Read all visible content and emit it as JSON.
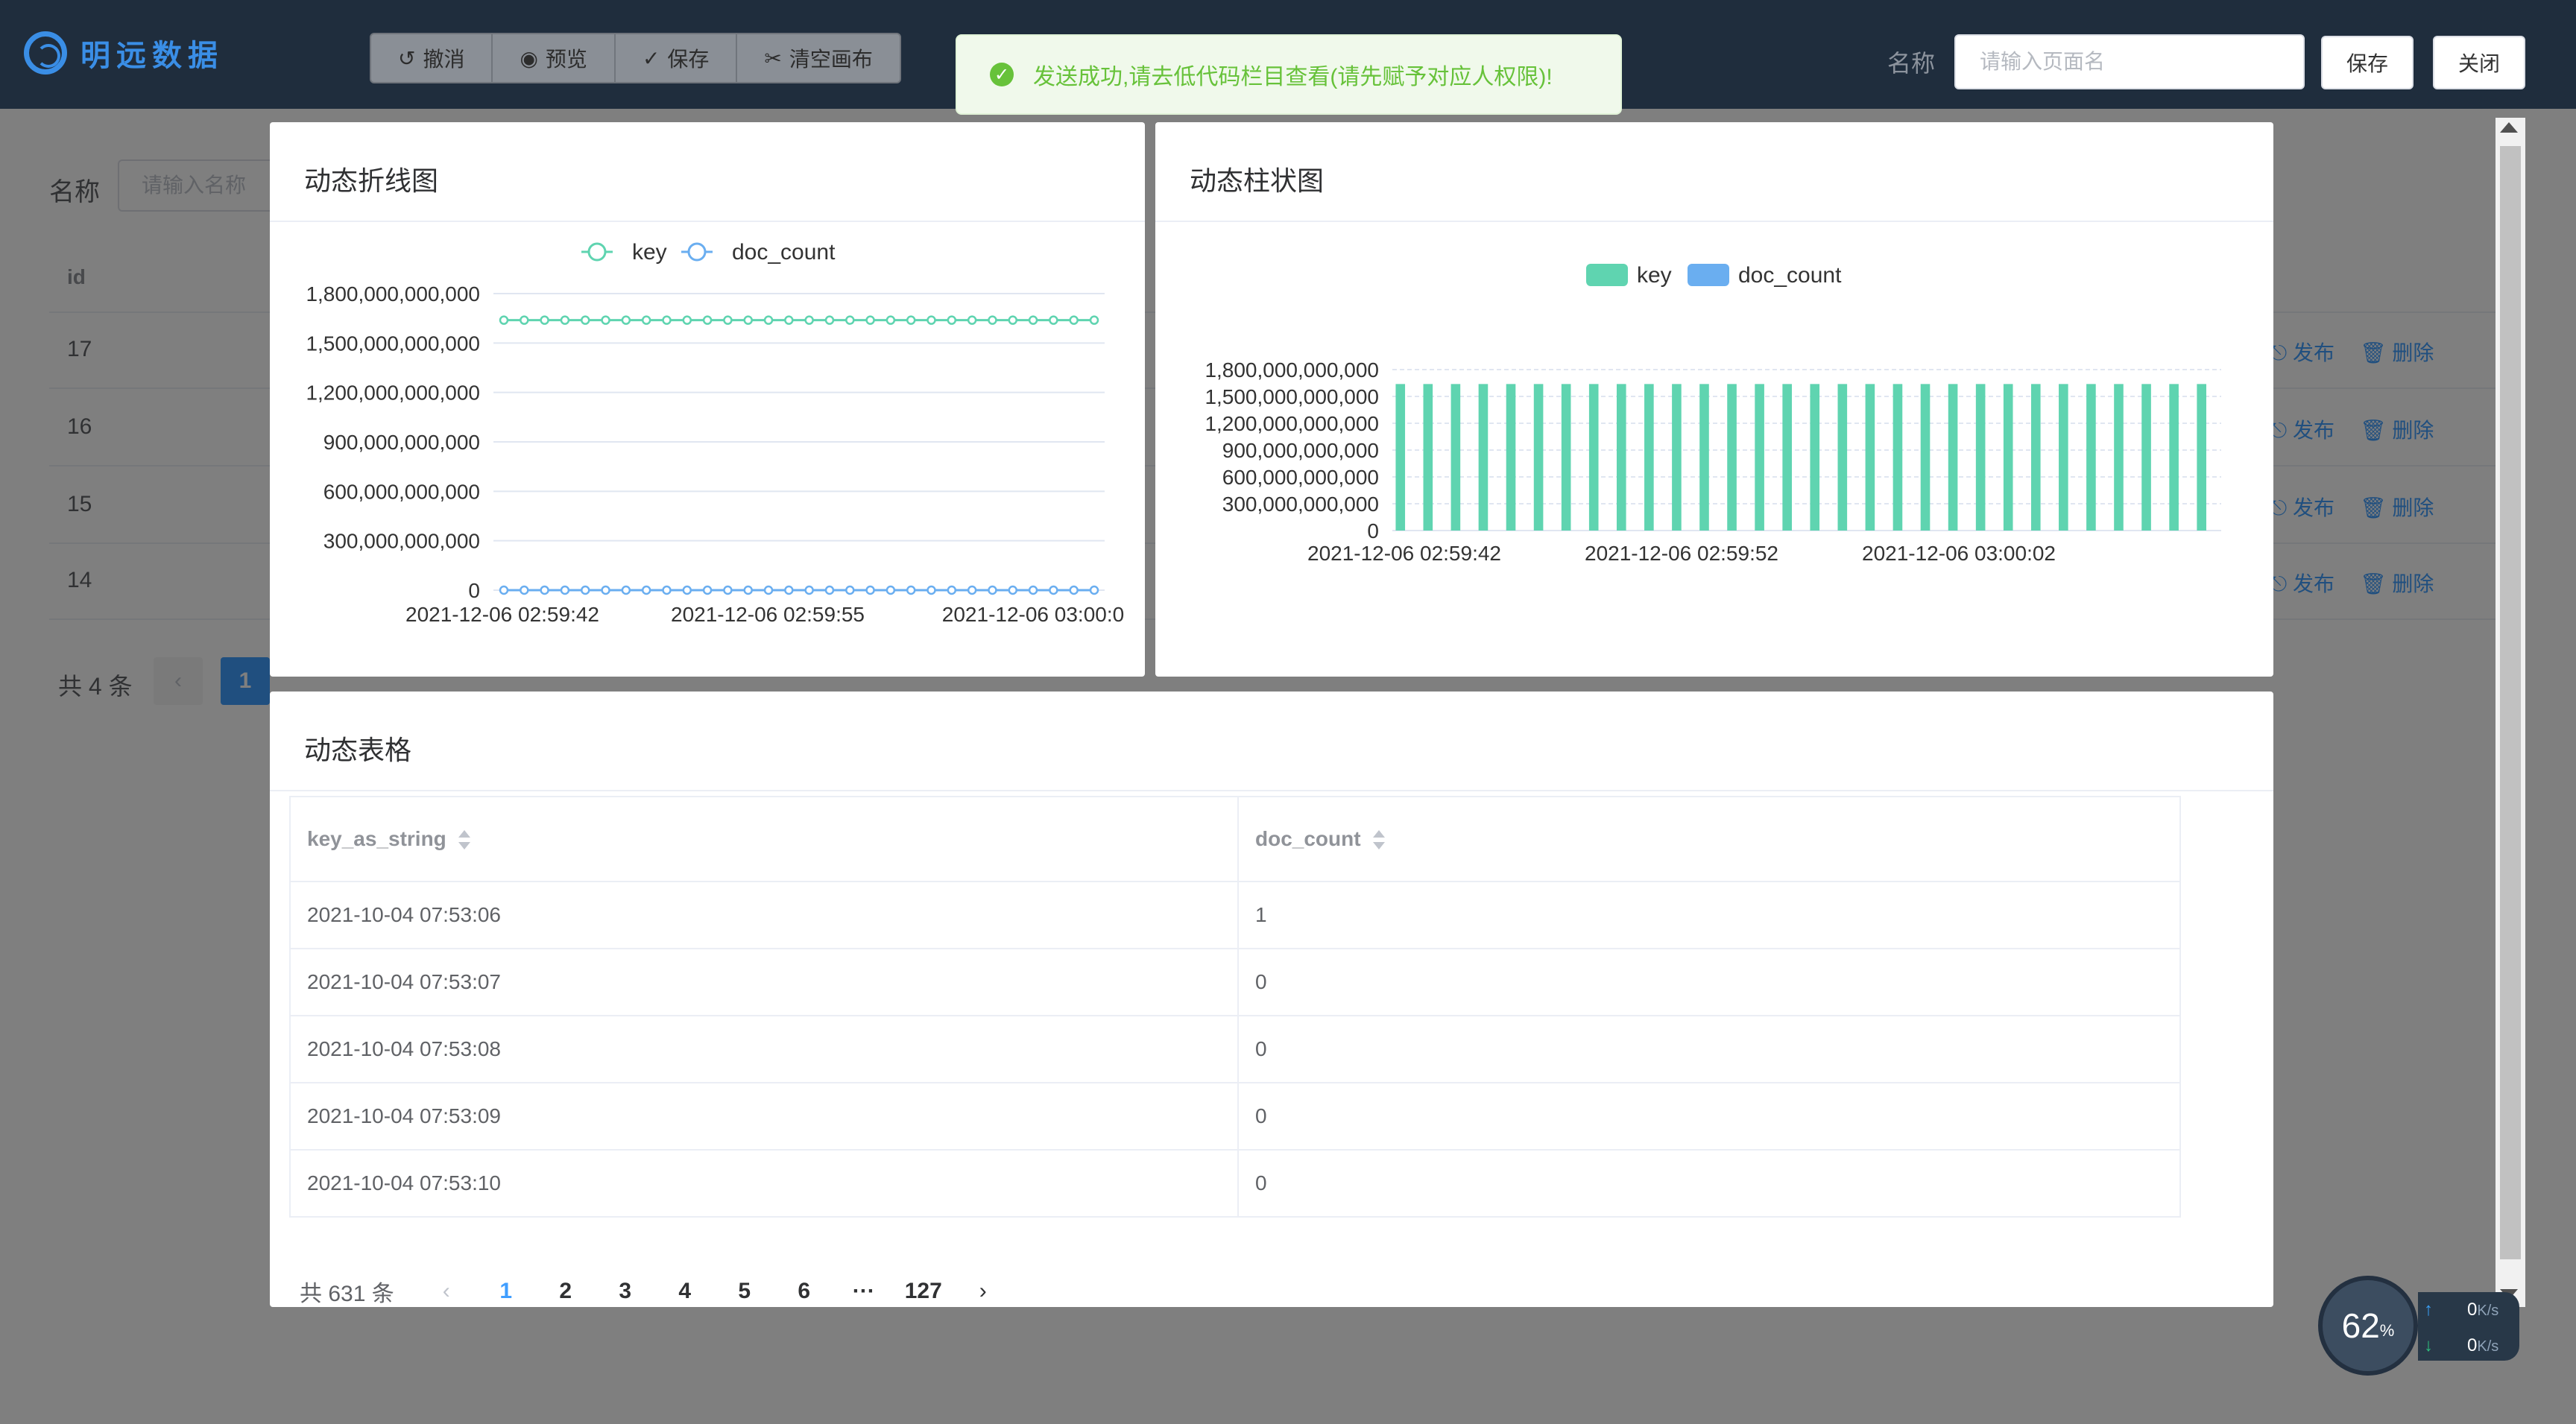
{
  "topbar": {
    "brand": "明远数据",
    "tools": [
      {
        "icon": "undo-icon",
        "label": "撤消"
      },
      {
        "icon": "eye-icon",
        "label": "预览"
      },
      {
        "icon": "edit-check-icon",
        "label": "保存"
      },
      {
        "icon": "scissors-icon",
        "label": "清空画布"
      }
    ],
    "name_label": "名称",
    "name_placeholder": "请输入页面名",
    "save_label": "保存",
    "close_label": "关闭"
  },
  "toast": {
    "message": "发送成功,请去低代码栏目查看(请先赋予对应人权限)!"
  },
  "background_page": {
    "name_label": "名称",
    "name_placeholder": "请输入名称",
    "id_header": "id",
    "rows": [
      {
        "id": "17",
        "publish": "发布",
        "delete": "删除"
      },
      {
        "id": "16",
        "publish": "发布",
        "delete": "删除"
      },
      {
        "id": "15",
        "publish": "发布",
        "delete": "删除"
      },
      {
        "id": "14",
        "publish": "发布",
        "delete": "删除"
      }
    ],
    "total": "共 4 条",
    "current_page": "1"
  },
  "line_panel": {
    "title": "动态折线图"
  },
  "bar_panel": {
    "title": "动态柱状图"
  },
  "table_panel": {
    "title": "动态表格",
    "columns": [
      "key_as_string",
      "doc_count"
    ],
    "rows": [
      [
        "2021-10-04 07:53:06",
        "1"
      ],
      [
        "2021-10-04 07:53:07",
        "0"
      ],
      [
        "2021-10-04 07:53:08",
        "0"
      ],
      [
        "2021-10-04 07:53:09",
        "0"
      ],
      [
        "2021-10-04 07:53:10",
        "0"
      ]
    ],
    "pagination": {
      "total": "共 631 条",
      "pages": [
        "1",
        "2",
        "3",
        "4",
        "5",
        "6",
        "···",
        "127"
      ],
      "current": "1"
    }
  },
  "network_widget": {
    "percent": "62",
    "percent_unit": "%",
    "up": "0",
    "down": "0",
    "unit": "K/s"
  },
  "colors": {
    "key_series": "#5fd4b0",
    "doc_series": "#6aaef0",
    "primary": "#409eff",
    "success": "#67c23a"
  },
  "chart_data": [
    {
      "type": "line",
      "title": "动态折线图",
      "series": [
        {
          "name": "key",
          "values": [
            1638730782000,
            1638730783000,
            1638730784000,
            1638730785000,
            1638730786000,
            1638730787000,
            1638730788000,
            1638730789000,
            1638730790000,
            1638730791000,
            1638730792000,
            1638730793000,
            1638730794000,
            1638730795000,
            1638730796000,
            1638730797000,
            1638730798000,
            1638730799000,
            1638730800000,
            1638730801000,
            1638730802000,
            1638730803000,
            1638730804000,
            1638730805000,
            1638730806000,
            1638730807000,
            1638730808000,
            1638730809000,
            1638730810000,
            1638730811000
          ]
        },
        {
          "name": "doc_count",
          "values": [
            0,
            0,
            0,
            0,
            0,
            0,
            0,
            0,
            0,
            0,
            0,
            0,
            0,
            0,
            0,
            0,
            0,
            0,
            0,
            0,
            0,
            0,
            0,
            0,
            0,
            0,
            0,
            0,
            0,
            0
          ]
        }
      ],
      "x_tick_labels": [
        "2021-12-06 02:59:42",
        "2021-12-06 02:59:55",
        "2021-12-06 03:00:0"
      ],
      "y_ticks": [
        "0",
        "300,000,000,000",
        "600,000,000,000",
        "900,000,000,000",
        "1,200,000,000,000",
        "1,500,000,000,000",
        "1,800,000,000,000"
      ],
      "ylim": [
        0,
        1800000000000
      ],
      "legend": "top-center",
      "grid": true
    },
    {
      "type": "bar",
      "title": "动态柱状图",
      "series": [
        {
          "name": "key",
          "values": [
            1638730782000,
            1638730783000,
            1638730784000,
            1638730785000,
            1638730786000,
            1638730787000,
            1638730788000,
            1638730789000,
            1638730790000,
            1638730791000,
            1638730792000,
            1638730793000,
            1638730794000,
            1638730795000,
            1638730796000,
            1638730797000,
            1638730798000,
            1638730799000,
            1638730800000,
            1638730801000,
            1638730802000,
            1638730803000,
            1638730804000,
            1638730805000,
            1638730806000,
            1638730807000,
            1638730808000,
            1638730809000,
            1638730810000,
            1638730811000
          ]
        },
        {
          "name": "doc_count",
          "values": [
            0,
            0,
            0,
            0,
            0,
            0,
            0,
            0,
            0,
            0,
            0,
            0,
            0,
            0,
            0,
            0,
            0,
            0,
            0,
            0,
            0,
            0,
            0,
            0,
            0,
            0,
            0,
            0,
            0,
            0
          ]
        }
      ],
      "x_tick_labels": [
        "2021-12-06 02:59:42",
        "2021-12-06 02:59:52",
        "2021-12-06 03:00:02"
      ],
      "y_ticks": [
        "0",
        "300,000,000,000",
        "600,000,000,000",
        "900,000,000,000",
        "1,200,000,000,000",
        "1,500,000,000,000",
        "1,800,000,000,000"
      ],
      "ylim": [
        0,
        1800000000000
      ],
      "legend": "top-center",
      "grid": true
    }
  ]
}
